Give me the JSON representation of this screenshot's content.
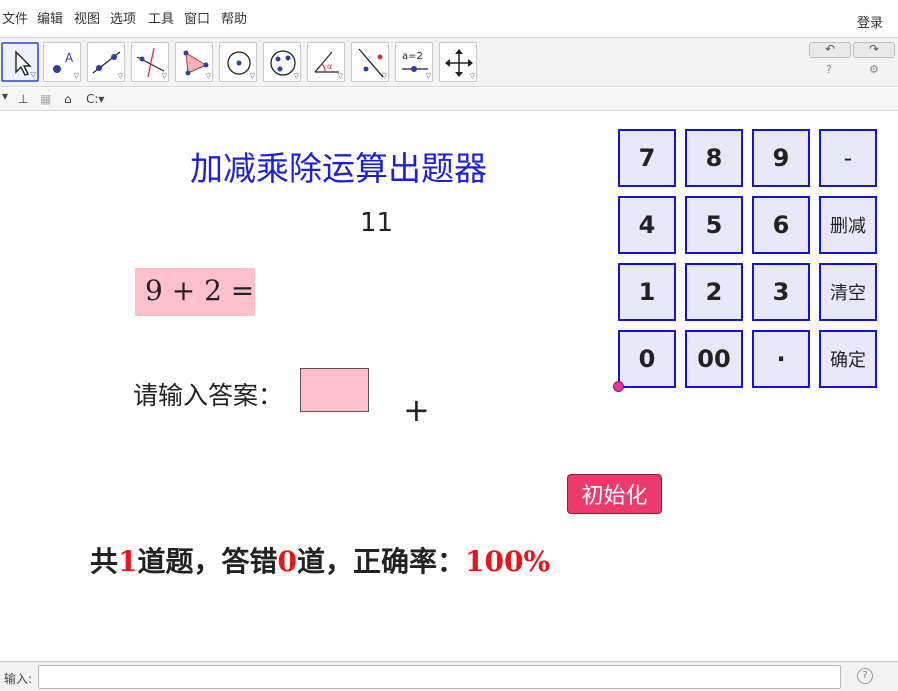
{
  "menu": {
    "items": [
      "文件",
      "编辑",
      "视图",
      "选项",
      "工具",
      "窗口",
      "帮助"
    ],
    "login": "登录"
  },
  "toolbar": {
    "tools": [
      "move-tool",
      "point-tool",
      "line-tool",
      "perpendicular-tool",
      "polygon-tool",
      "circle-tool",
      "conic-tool",
      "angle-tool",
      "reflect-tool",
      "slider-tool",
      "move-graphics-tool"
    ],
    "undo": "↶",
    "redo": "↷",
    "help": "?",
    "settings": "⚙",
    "slider_label": "a=2"
  },
  "viewbar": {
    "arrow": "▾",
    "axes": "⊥",
    "grid": "▦",
    "home": "⌂",
    "mode": "C:▾"
  },
  "app": {
    "title": "加减乘除运算出题器",
    "result": "11",
    "question": "9 + 2 =",
    "prompt": "请输入答案：",
    "crosshair": "+"
  },
  "keypad": {
    "keys": [
      "7",
      "8",
      "9",
      "-",
      "4",
      "5",
      "6",
      "删减",
      "1",
      "2",
      "3",
      "清空",
      "0",
      "00",
      "·",
      "确定"
    ]
  },
  "init_button": "初始化",
  "stats": {
    "prefix": "共",
    "total": "1",
    "middle": "道题，答错",
    "wrong": "0",
    "suffix": "道，正确率：",
    "rate": "100%"
  },
  "inputbar": {
    "label": "输入:",
    "help": "?"
  },
  "colors": {
    "title": "#1f1fd6",
    "key_border": "#1515d0",
    "pink": "#ffc0cb",
    "init_button": "#ec3a6a",
    "highlight": "#e8141a"
  }
}
